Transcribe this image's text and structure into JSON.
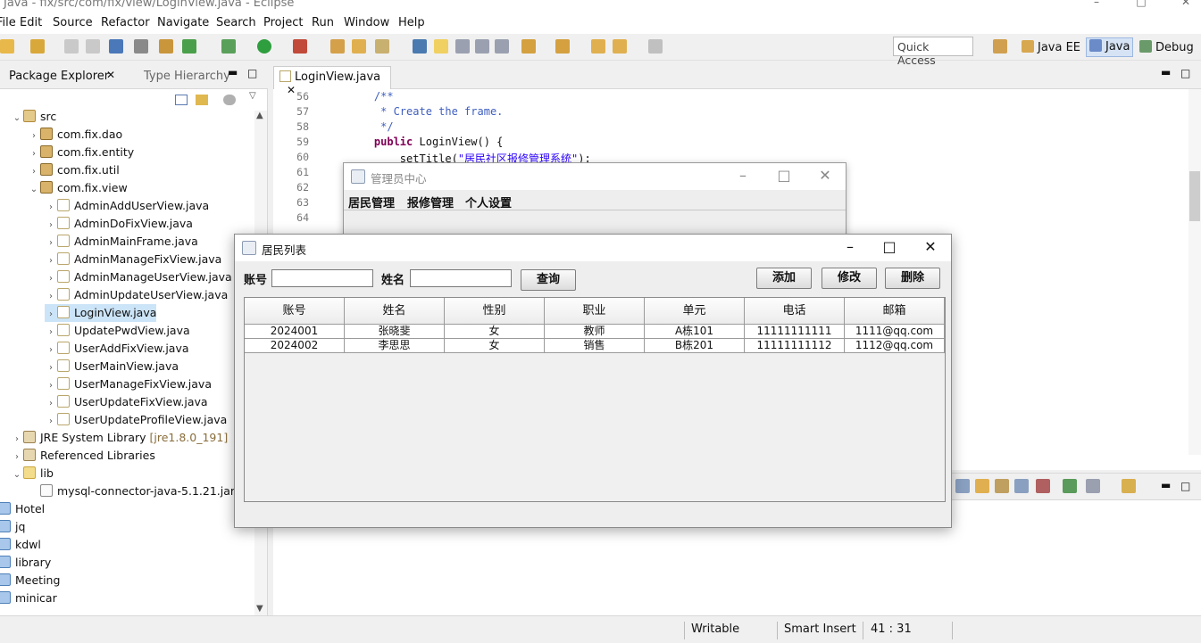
{
  "window": {
    "title": "Java - fix/src/com/fix/view/LoginView.java - Eclipse"
  },
  "menubar": [
    "File",
    "Edit",
    "Source",
    "Refactor",
    "Navigate",
    "Search",
    "Project",
    "Run",
    "Window",
    "Help"
  ],
  "toolbar": {
    "quick_access": "Quick Access",
    "perspectives": [
      "Java EE",
      "Java",
      "Debug"
    ]
  },
  "package_explorer": {
    "tabs": [
      "Package Explorer",
      "Type Hierarchy"
    ],
    "tree": [
      {
        "label": "src",
        "level": 0,
        "icon": "src-folder-icon",
        "expanded": true
      },
      {
        "label": "com.fix.dao",
        "level": 1,
        "icon": "package-icon",
        "expanded": false
      },
      {
        "label": "com.fix.entity",
        "level": 1,
        "icon": "package-icon",
        "expanded": false
      },
      {
        "label": "com.fix.util",
        "level": 1,
        "icon": "package-icon",
        "expanded": false
      },
      {
        "label": "com.fix.view",
        "level": 1,
        "icon": "package-icon",
        "expanded": true
      },
      {
        "label": "AdminAddUserView.java",
        "level": 2,
        "icon": "java-file-icon"
      },
      {
        "label": "AdminDoFixView.java",
        "level": 2,
        "icon": "java-file-icon"
      },
      {
        "label": "AdminMainFrame.java",
        "level": 2,
        "icon": "java-file-icon"
      },
      {
        "label": "AdminManageFixView.java",
        "level": 2,
        "icon": "java-file-icon"
      },
      {
        "label": "AdminManageUserView.java",
        "level": 2,
        "icon": "java-file-icon"
      },
      {
        "label": "AdminUpdateUserView.java",
        "level": 2,
        "icon": "java-file-icon"
      },
      {
        "label": "LoginView.java",
        "level": 2,
        "icon": "java-file-icon",
        "selected": true
      },
      {
        "label": "UpdatePwdView.java",
        "level": 2,
        "icon": "java-file-icon"
      },
      {
        "label": "UserAddFixView.java",
        "level": 2,
        "icon": "java-file-icon"
      },
      {
        "label": "UserMainView.java",
        "level": 2,
        "icon": "java-file-icon"
      },
      {
        "label": "UserManageFixView.java",
        "level": 2,
        "icon": "java-file-icon"
      },
      {
        "label": "UserUpdateFixView.java",
        "level": 2,
        "icon": "java-file-icon"
      },
      {
        "label": "UserUpdateProfileView.java",
        "level": 2,
        "icon": "java-file-icon"
      },
      {
        "label": "JRE System Library",
        "suffix": "[jre1.8.0_191]",
        "level": 0,
        "icon": "library-icon",
        "expanded": false
      },
      {
        "label": "Referenced Libraries",
        "level": 0,
        "icon": "library-icon",
        "expanded": false
      },
      {
        "label": "lib",
        "level": 0,
        "icon": "folder-icon",
        "expanded": true
      },
      {
        "label": "mysql-connector-java-5.1.21.jar",
        "level": 1,
        "icon": "jar-icon"
      },
      {
        "label": "Hotel",
        "level": -1,
        "icon": "project-icon"
      },
      {
        "label": "jq",
        "level": -1,
        "icon": "project-icon"
      },
      {
        "label": "kdwl",
        "level": -1,
        "icon": "project-icon"
      },
      {
        "label": "library",
        "level": -1,
        "icon": "project-icon"
      },
      {
        "label": "Meeting",
        "level": -1,
        "icon": "project-icon"
      },
      {
        "label": "minicar",
        "level": -1,
        "icon": "project-icon"
      }
    ]
  },
  "editor": {
    "tab": "LoginView.java",
    "lines": [
      {
        "n": "56",
        "code": "    /**"
      },
      {
        "n": "57",
        "code": "     * Create the frame."
      },
      {
        "n": "58",
        "code": "     */"
      },
      {
        "n": "59",
        "code": "    public LoginView() {"
      },
      {
        "n": "60",
        "code": "        setTitle(\"居民社区报修管理系统\");"
      },
      {
        "n": "61",
        "code": ""
      },
      {
        "n": "62",
        "code": ""
      },
      {
        "n": "63",
        "code": ""
      },
      {
        "n": "64",
        "code": ""
      }
    ]
  },
  "status_bar": {
    "writable": "Writable",
    "insert_mode": "Smart Insert",
    "position": "41 : 31"
  },
  "admin_dialog": {
    "title": "管理员中心",
    "menu": [
      "居民管理",
      "报修管理",
      "个人设置"
    ]
  },
  "resident_dialog": {
    "title": "居民列表",
    "account_label": "账号",
    "name_label": "姓名",
    "query_button": "查询",
    "add_button": "添加",
    "edit_button": "修改",
    "delete_button": "删除",
    "columns": [
      "账号",
      "姓名",
      "性别",
      "职业",
      "单元",
      "电话",
      "邮箱"
    ],
    "rows": [
      [
        "2024001",
        "张晓斐",
        "女",
        "教师",
        "A栋101",
        "11111111111",
        "1111@qq.com"
      ],
      [
        "2024002",
        "李思思",
        "女",
        "销售",
        "B栋201",
        "11111111112",
        "1112@qq.com"
      ]
    ]
  }
}
